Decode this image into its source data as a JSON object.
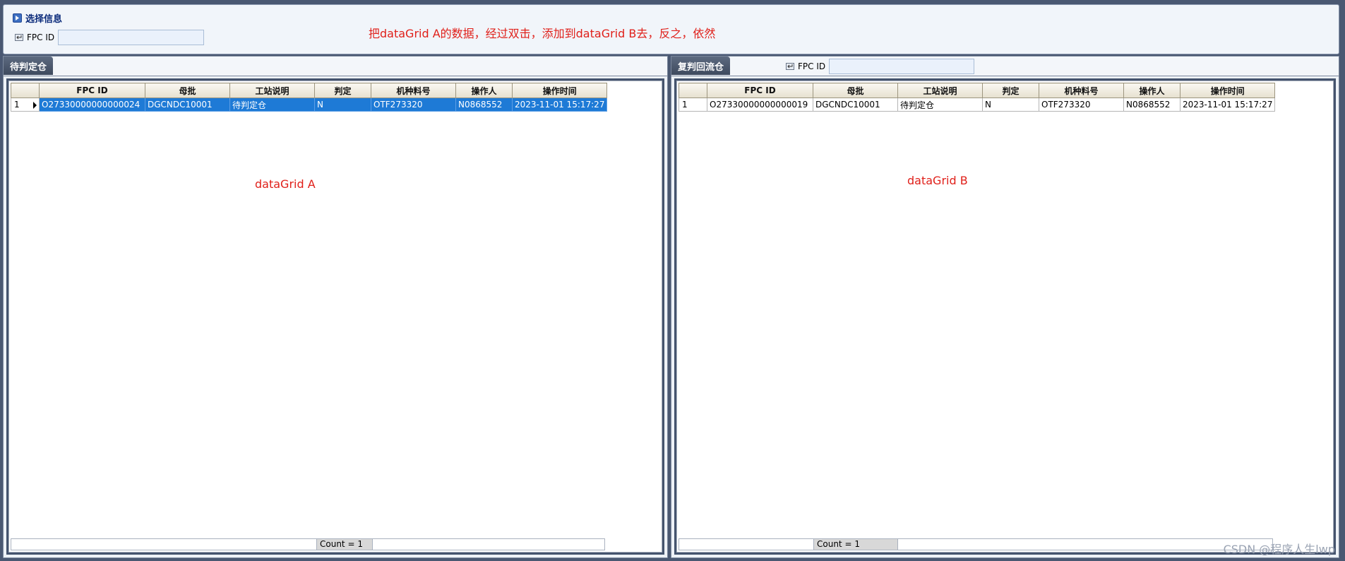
{
  "selection_panel": {
    "title": "选择信息",
    "fpc_label": "FPC ID",
    "fpc_value": ""
  },
  "note": "把dataGrid A的数据，经过双击，添加到dataGrid B去，反之，依然",
  "columns": [
    "FPC ID",
    "母批",
    "工站说明",
    "判定",
    "机种料号",
    "操作人",
    "操作时间"
  ],
  "grid_a": {
    "tab": "待判定仓",
    "label": "dataGrid A",
    "count": "Count = 1",
    "rows": [
      {
        "num": "1",
        "cells": [
          "O27330000000000024",
          "DGCNDC10001",
          "待判定仓",
          "N",
          "OTF273320",
          "N0868552",
          "2023-11-01 15:17:27"
        ]
      }
    ]
  },
  "grid_b": {
    "tab": "复判回流仓",
    "fpc_label": "FPC ID",
    "fpc_value": "",
    "label": "dataGrid B",
    "count": "Count = 1",
    "rows": [
      {
        "num": "1",
        "cells": [
          "O27330000000000019",
          "DGCNDC10001",
          "待判定仓",
          "N",
          "OTF273320",
          "N0868552",
          "2023-11-01 15:17:27"
        ]
      }
    ]
  },
  "watermark": "CSDN @程序人生lwp",
  "colors": {
    "selection": "#1e7ad6",
    "note": "#e0201a",
    "tab": "#4b586d"
  }
}
